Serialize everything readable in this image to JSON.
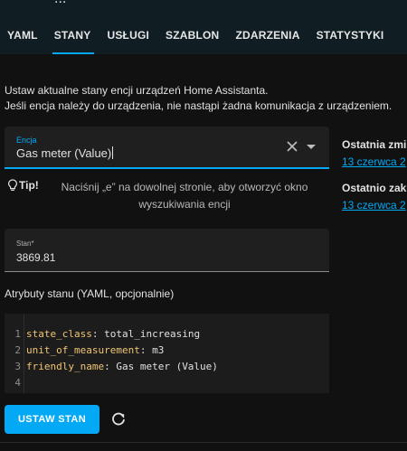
{
  "header": {
    "clipped_title": "..."
  },
  "tabs": [
    {
      "label": "YAML"
    },
    {
      "label": "STANY",
      "active": true
    },
    {
      "label": "USŁUGI"
    },
    {
      "label": "SZABLON"
    },
    {
      "label": "ZDARZENIA"
    },
    {
      "label": "STATYSTYKI"
    }
  ],
  "intro": {
    "line1": "Ustaw aktualne stany encji urządzeń Home Assistanta.",
    "line2": "Jeśli encja należy do urządzenia, nie nastąpi żadna komunikacja z urządzeniem."
  },
  "entity_field": {
    "label": "Encja",
    "value": "Gas meter (Value)"
  },
  "tip": {
    "label": "Tip!",
    "text": "Naciśnij „e” na dowolnej stronie, aby otworzyć okno wyszukiwania encji"
  },
  "state_field": {
    "label": "Stan*",
    "value": "3869.81"
  },
  "attributes": {
    "title": "Atrybuty stanu (YAML, opcjonalnie)",
    "lines": [
      {
        "num": "1",
        "key": "state_class",
        "value": " total_increasing"
      },
      {
        "num": "2",
        "key": "unit_of_measurement",
        "value": " m3"
      },
      {
        "num": "3",
        "key": "friendly_name",
        "value": " Gas meter (Value)"
      },
      {
        "num": "4",
        "key": "",
        "value": ""
      }
    ]
  },
  "actions": {
    "set_state_label": "USTAW STAN"
  },
  "sidebar": {
    "last_changed_label": "Ostatnia zmi",
    "last_changed_value": "13 czerwca 2",
    "last_updated_label": "Ostatnio zak",
    "last_updated_value": "13 czerwca 2"
  },
  "colors": {
    "accent": "#03a9f4",
    "background": "#111111",
    "field_background": "#1f1f1f",
    "yaml_key": "#f0c674"
  }
}
